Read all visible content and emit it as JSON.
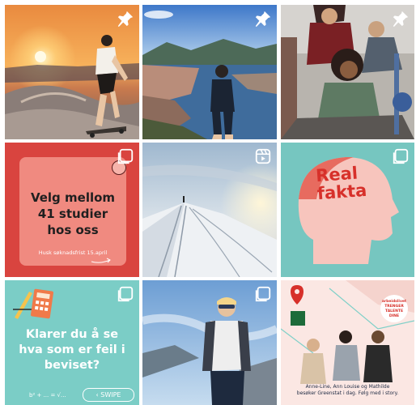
{
  "feed": {
    "tiles": [
      {
        "kind": "photo",
        "subject": "skateboarder-at-sunset",
        "badge": "pin-icon"
      },
      {
        "kind": "photo",
        "subject": "hiker-overlooking-city-fjord",
        "badge": "pin-icon"
      },
      {
        "kind": "photo",
        "subject": "students-laughing-on-floor",
        "badge": "pin-icon"
      },
      {
        "kind": "graphic",
        "badge": "carousel-icon",
        "headline_1": "Velg mellom",
        "headline_2": "41 studier",
        "headline_3": "hos oss",
        "subline": "Husk søknadsfrist 15.april",
        "bg": "#d9443f",
        "card": "#f08a80"
      },
      {
        "kind": "photo",
        "subject": "ski-tracks-on-snow-ridge",
        "badge": "reel-icon"
      },
      {
        "kind": "graphic",
        "badge": "carousel-icon",
        "title_1": "Real",
        "title_2": "fakta",
        "bg": "#76c6c0",
        "title_color": "#d7302a"
      },
      {
        "kind": "graphic",
        "badge": "carousel-icon",
        "question_1": "Klarer du å se",
        "question_2": "hva som er feil i",
        "question_3": "beviset?",
        "swipe_label": "SWIPE",
        "formula": "b² + ... = √...",
        "bg": "#7bcdc6"
      },
      {
        "kind": "photo",
        "subject": "hiker-with-backpack-on-mountain",
        "badge": "carousel-icon"
      },
      {
        "kind": "graphic",
        "badge": "none",
        "caption_1": "Anne-Line, Ann Louise og Mathilde",
        "caption_2": "besøker Greenstat i dag. Følg med i story.",
        "event_1": "arbeidslivet",
        "event_2": "TRENGER",
        "event_3": "TALENTE",
        "event_4": "DINE",
        "bg": "#fbe7e3"
      }
    ]
  }
}
